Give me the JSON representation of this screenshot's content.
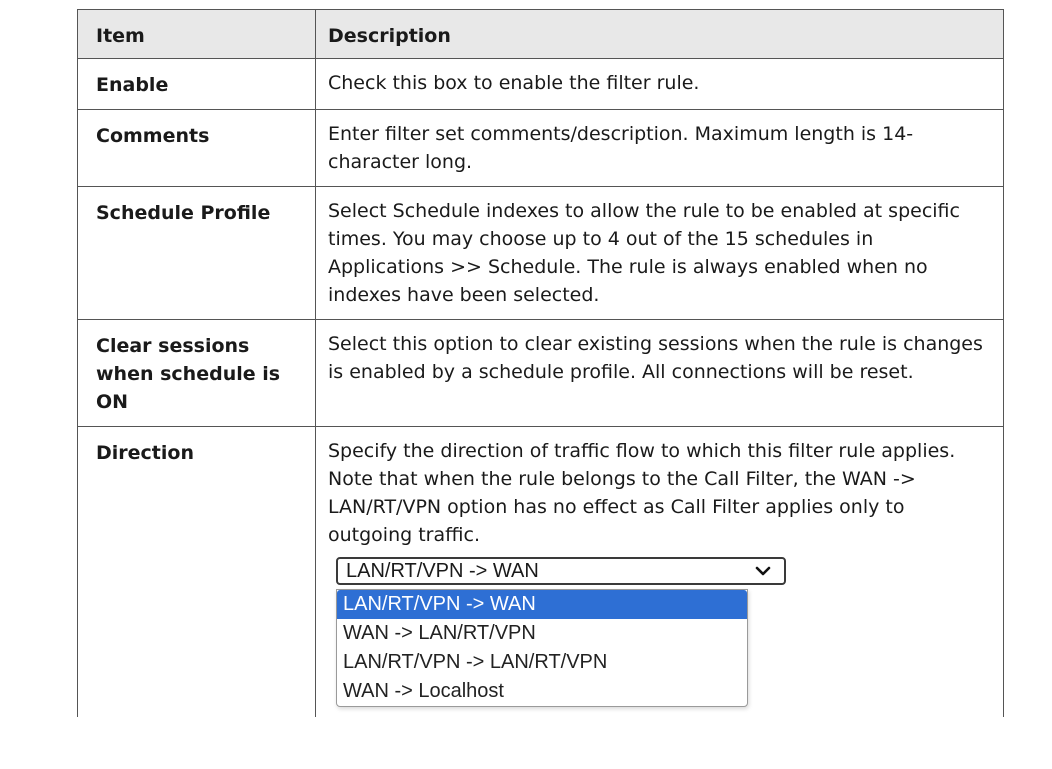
{
  "table": {
    "headers": [
      "Item",
      "Description"
    ],
    "rows": [
      {
        "item": "Enable",
        "description": "Check this box to enable the filter rule."
      },
      {
        "item": "Comments",
        "description": "Enter filter set comments/description. Maximum length is 14- character long."
      },
      {
        "item": "Schedule Profile",
        "description": "Select Schedule indexes to allow the rule to be enabled at specific times. You may choose up to 4 out of the 15 schedules in Applications >> Schedule. The rule is always enabled when no indexes have been selected."
      },
      {
        "item": "Clear sessions when schedule is ON",
        "description": "Select this option to clear existing sessions when the rule is changes is enabled by a schedule profile. All connections will be reset."
      },
      {
        "item": "Direction",
        "description": "Specify the direction of traffic flow to which this filter rule applies. Note that when the rule belongs to the Call Filter, the WAN -> LAN/RT/VPN option has no effect as Call Filter applies only to outgoing traffic."
      }
    ]
  },
  "direction_select": {
    "selected": "LAN/RT/VPN -> WAN",
    "options": [
      "LAN/RT/VPN -> WAN",
      "WAN -> LAN/RT/VPN",
      "LAN/RT/VPN -> LAN/RT/VPN",
      "WAN -> Localhost"
    ],
    "highlighted_index": 0,
    "highlight_color": "#2e6fd4",
    "icon": "chevron-down-icon"
  }
}
